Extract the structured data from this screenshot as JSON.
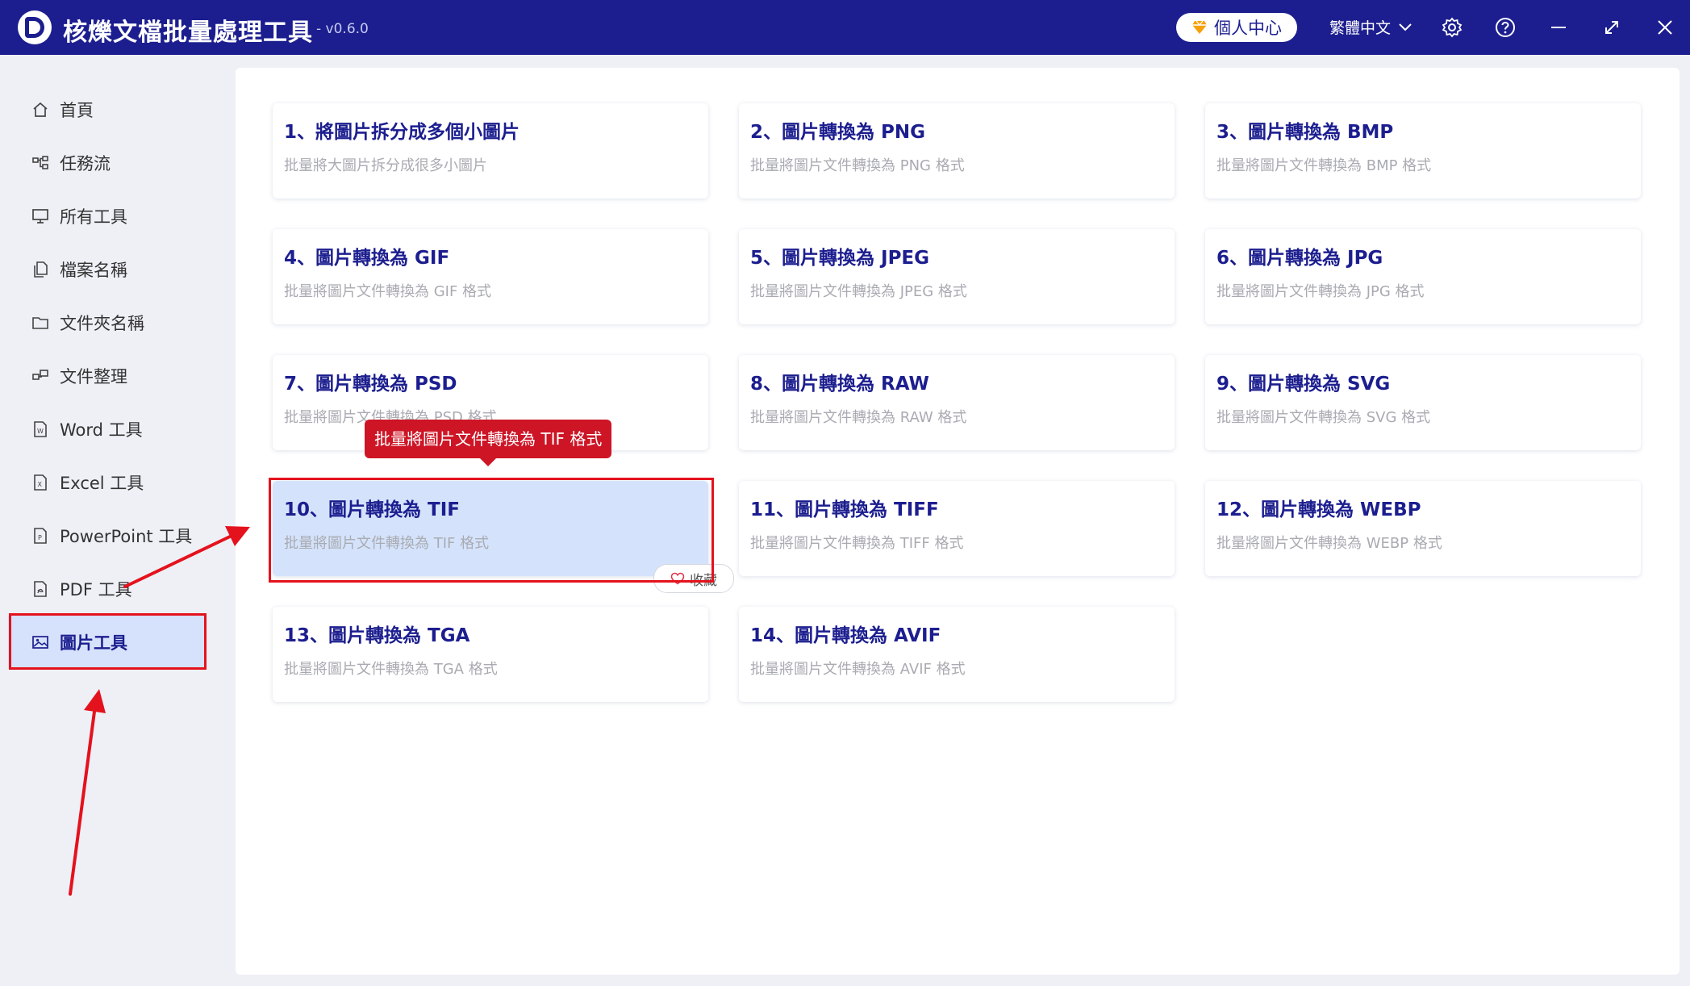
{
  "app": {
    "title": "核爍文檔批量處理工具",
    "version": "- v0.6.0",
    "user_center_label": "個人中心",
    "language": "繁體中文"
  },
  "sidebar": {
    "items": [
      {
        "label": "首頁",
        "icon": "home-icon"
      },
      {
        "label": "任務流",
        "icon": "workflow-icon"
      },
      {
        "label": "所有工具",
        "icon": "monitor-icon"
      },
      {
        "label": "檔案名稱",
        "icon": "file-copy-icon"
      },
      {
        "label": "文件夾名稱",
        "icon": "folder-icon"
      },
      {
        "label": "文件整理",
        "icon": "organize-icon"
      },
      {
        "label": "Word 工具",
        "icon": "word-file-icon"
      },
      {
        "label": "Excel 工具",
        "icon": "excel-file-icon"
      },
      {
        "label": "PowerPoint 工具",
        "icon": "ppt-file-icon"
      },
      {
        "label": "PDF 工具",
        "icon": "pdf-file-icon"
      },
      {
        "label": "圖片工具",
        "icon": "image-icon",
        "active": true
      }
    ]
  },
  "tools": [
    {
      "title": "1、將圖片拆分成多個小圖片",
      "desc": "批量將大圖片拆分成很多小圖片"
    },
    {
      "title": "2、圖片轉換為 PNG",
      "desc": "批量將圖片文件轉換為 PNG 格式"
    },
    {
      "title": "3、圖片轉換為 BMP",
      "desc": "批量將圖片文件轉換為 BMP 格式"
    },
    {
      "title": "4、圖片轉換為 GIF",
      "desc": "批量將圖片文件轉換為 GIF 格式"
    },
    {
      "title": "5、圖片轉換為 JPEG",
      "desc": "批量將圖片文件轉換為 JPEG 格式"
    },
    {
      "title": "6、圖片轉換為 JPG",
      "desc": "批量將圖片文件轉換為 JPG 格式"
    },
    {
      "title": "7、圖片轉換為 PSD",
      "desc": "批量將圖片文件轉換為 PSD 格式"
    },
    {
      "title": "8、圖片轉換為 RAW",
      "desc": "批量將圖片文件轉換為 RAW 格式"
    },
    {
      "title": "9、圖片轉換為 SVG",
      "desc": "批量將圖片文件轉換為 SVG 格式"
    },
    {
      "title": "10、圖片轉換為 TIF",
      "desc": "批量將圖片文件轉換為 TIF 格式",
      "selected": true
    },
    {
      "title": "11、圖片轉換為 TIFF",
      "desc": "批量將圖片文件轉換為 TIFF 格式"
    },
    {
      "title": "12、圖片轉換為 WEBP",
      "desc": "批量將圖片文件轉換為 WEBP 格式"
    },
    {
      "title": "13、圖片轉換為 TGA",
      "desc": "批量將圖片文件轉換為 TGA 格式"
    },
    {
      "title": "14、圖片轉換為 AVIF",
      "desc": "批量將圖片文件轉換為 AVIF 格式"
    }
  ],
  "tooltip": {
    "text": "批量將圖片文件轉換為 TIF 格式"
  },
  "favorite": {
    "label": "收藏",
    "icon": "heart-icon"
  },
  "colors": {
    "titlebar": "#1c1e8f",
    "accent": "#1c1e8f",
    "highlight": "#e4121d",
    "tooltip": "#cd1526"
  }
}
